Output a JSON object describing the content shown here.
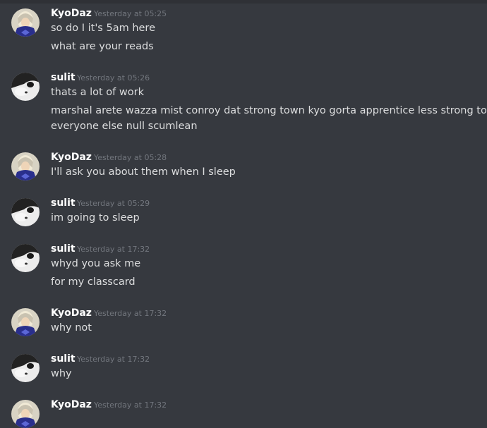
{
  "messages": [
    {
      "author": "KyoDaz",
      "avatar": "kyodaz-avatar",
      "timestamp": "Yesterday at 05:25",
      "lines": [
        "so do I it's 5am here",
        "what are your reads"
      ]
    },
    {
      "author": "sulit",
      "avatar": "sulit-avatar",
      "timestamp": "Yesterday at 05:26",
      "lines": [
        "thats a lot of work",
        "marshal arete wazza mist conroy dat strong town kyo gorta apprentice less strong town",
        "everyone else null scumlean"
      ]
    },
    {
      "author": "KyoDaz",
      "avatar": "kyodaz-avatar",
      "timestamp": "Yesterday at 05:28",
      "lines": [
        "I'll ask you about them when I sleep"
      ]
    },
    {
      "author": "sulit",
      "avatar": "sulit-avatar",
      "timestamp": "Yesterday at 05:29",
      "lines": [
        "im going to sleep"
      ]
    },
    {
      "author": "sulit",
      "avatar": "sulit-avatar",
      "timestamp": "Yesterday at 17:32",
      "lines": [
        "whyd you ask me",
        "for my classcard"
      ]
    },
    {
      "author": "KyoDaz",
      "avatar": "kyodaz-avatar",
      "timestamp": "Yesterday at 17:32",
      "lines": [
        "why not"
      ]
    },
    {
      "author": "sulit",
      "avatar": "sulit-avatar",
      "timestamp": "Yesterday at 17:32",
      "lines": [
        "why"
      ]
    },
    {
      "author": "KyoDaz",
      "avatar": "kyodaz-avatar",
      "timestamp": "Yesterday at 17:32",
      "lines": []
    }
  ],
  "colors": {
    "background": "#36393f",
    "username": "#ffffff",
    "message_text": "#dcddde",
    "timestamp": "#72767d"
  }
}
